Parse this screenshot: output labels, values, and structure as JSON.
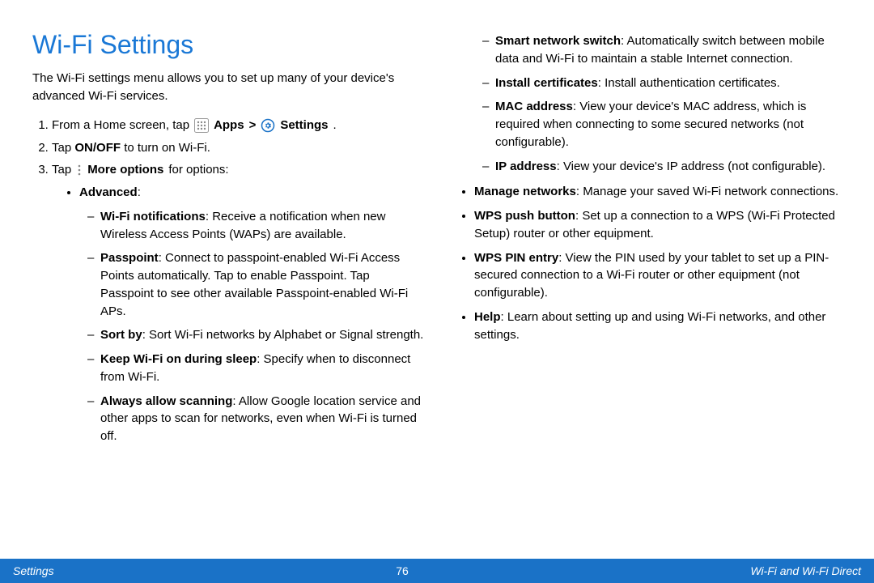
{
  "title": "Wi-Fi Settings",
  "intro": "The Wi-Fi settings menu allows you to set up many of your device's advanced Wi-Fi services.",
  "step1": {
    "pre": "From a Home screen, tap",
    "apps": "Apps",
    "gt": ">",
    "settings": "Settings",
    "post": "."
  },
  "step2": {
    "t1": "Tap ",
    "b": "ON/OFF",
    "t2": " to turn on Wi-Fi."
  },
  "step3": {
    "t1": "Tap ",
    "b": "More options",
    "t2": " for options:"
  },
  "adv_label": "Advanced",
  "left_dashes": [
    {
      "b": "Wi-Fi notifications",
      "t": ": Receive a notification when new Wireless Access Points (WAPs) are available."
    },
    {
      "b": "Passpoint",
      "t": ": Connect to passpoint-enabled Wi-Fi Access Points automatically. Tap  to enable Passpoint. Tap Passpoint to see other available Passpoint-enabled Wi-Fi APs."
    },
    {
      "b": "Sort by",
      "t": ": Sort Wi-Fi networks by Alphabet  or Signal strength."
    },
    {
      "b": "Keep Wi-Fi on during sleep",
      "t": ": Specify when to disconnect from Wi-Fi."
    },
    {
      "b": "Always allow scanning",
      "t": ": Allow Google location service and other apps to scan for networks, even when Wi-Fi is turned off."
    }
  ],
  "right_dashes": [
    {
      "b": "Smart network switch",
      "t": ": Automatically switch between mobile data and Wi-Fi to maintain a stable Internet connection."
    },
    {
      "b": "Install certificates",
      "t": ": Install authentication certificates."
    },
    {
      "b": "MAC address",
      "t": ": View your device's MAC address, which is required when connecting to some secured networks (not configurable)."
    },
    {
      "b": "IP address",
      "t": ": View your device's IP address (not configurable)."
    }
  ],
  "right_bullets": [
    {
      "b": "Manage networks",
      "t": ": Manage your saved Wi-Fi network connections."
    },
    {
      "b": "WPS push button",
      "t": ": Set up a connection to a WPS (Wi-Fi Protected Setup) router or other equipment."
    },
    {
      "b": "WPS PIN entry",
      "t": ": View the PIN used by your tablet to set up a PIN-secured connection to a Wi-Fi router or other equipment (not configurable)."
    },
    {
      "b": "Help",
      "t": ": Learn about setting up and using Wi-Fi networks, and other settings."
    }
  ],
  "footer": {
    "left": "Settings",
    "page": "76",
    "right": "Wi-Fi and Wi-Fi Direct"
  }
}
